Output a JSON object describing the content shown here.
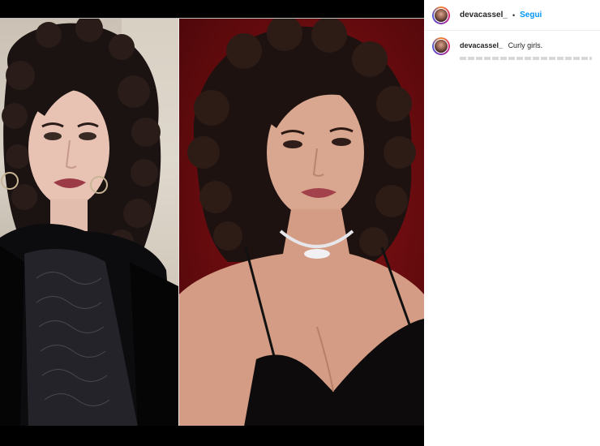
{
  "post": {
    "media_alt": "",
    "author": {
      "username": "devacassel_",
      "separator": "•",
      "follow_label": "Segui"
    },
    "caption": {
      "username": "devacassel_",
      "text": "Curly girls."
    }
  },
  "colors": {
    "follow_blue": "#0095f6",
    "text": "#262626",
    "media_background": "#000000",
    "right_backdrop_red": "#7a0f13"
  }
}
